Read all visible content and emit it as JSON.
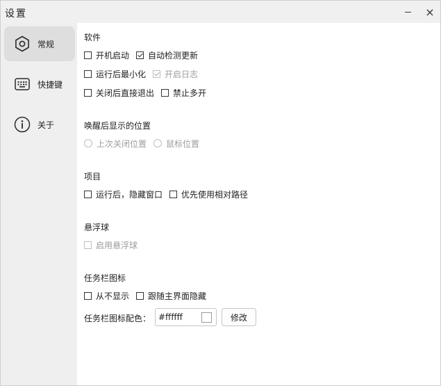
{
  "window": {
    "title": "设置",
    "minimize_icon": "minimize-icon",
    "close_symbol": "×"
  },
  "sidebar": {
    "items": [
      {
        "label": "常规",
        "icon": "gear-icon",
        "active": true
      },
      {
        "label": "快捷键",
        "icon": "keyboard-icon",
        "active": false
      },
      {
        "label": "关于",
        "icon": "info-icon",
        "active": false
      }
    ]
  },
  "software": {
    "title": "软件",
    "auto_start": {
      "label": "开机启动",
      "checked": false
    },
    "auto_update": {
      "label": "自动检测更新",
      "checked": true
    },
    "minimize_after_run": {
      "label": "运行后最小化",
      "checked": false
    },
    "enable_log": {
      "label": "开启日志",
      "checked": true,
      "disabled": true
    },
    "exit_on_close": {
      "label": "关闭后直接退出",
      "checked": false
    },
    "disable_multi": {
      "label": "禁止多开",
      "checked": false
    }
  },
  "wake_position": {
    "title": "唤醒后显示的位置",
    "last_close": {
      "label": "上次关闭位置",
      "disabled": true
    },
    "mouse_position": {
      "label": "鼠标位置",
      "disabled": true
    }
  },
  "project": {
    "title": "项目",
    "hide_after_run": {
      "label": "运行后，隐藏窗口",
      "checked": false
    },
    "relative_path": {
      "label": "优先使用相对路径",
      "checked": false
    }
  },
  "float_ball": {
    "title": "悬浮球",
    "enable": {
      "label": "启用悬浮球",
      "checked": false,
      "disabled": true
    }
  },
  "tray": {
    "title": "任务栏图标",
    "never_show": {
      "label": "从不显示",
      "checked": false
    },
    "follow_main": {
      "label": "跟随主界面隐藏",
      "checked": false
    },
    "color_label": "任务栏图标配色：",
    "color_value": "#ffffff",
    "swatch_color": "#ffffff",
    "modify_label": "修改"
  }
}
